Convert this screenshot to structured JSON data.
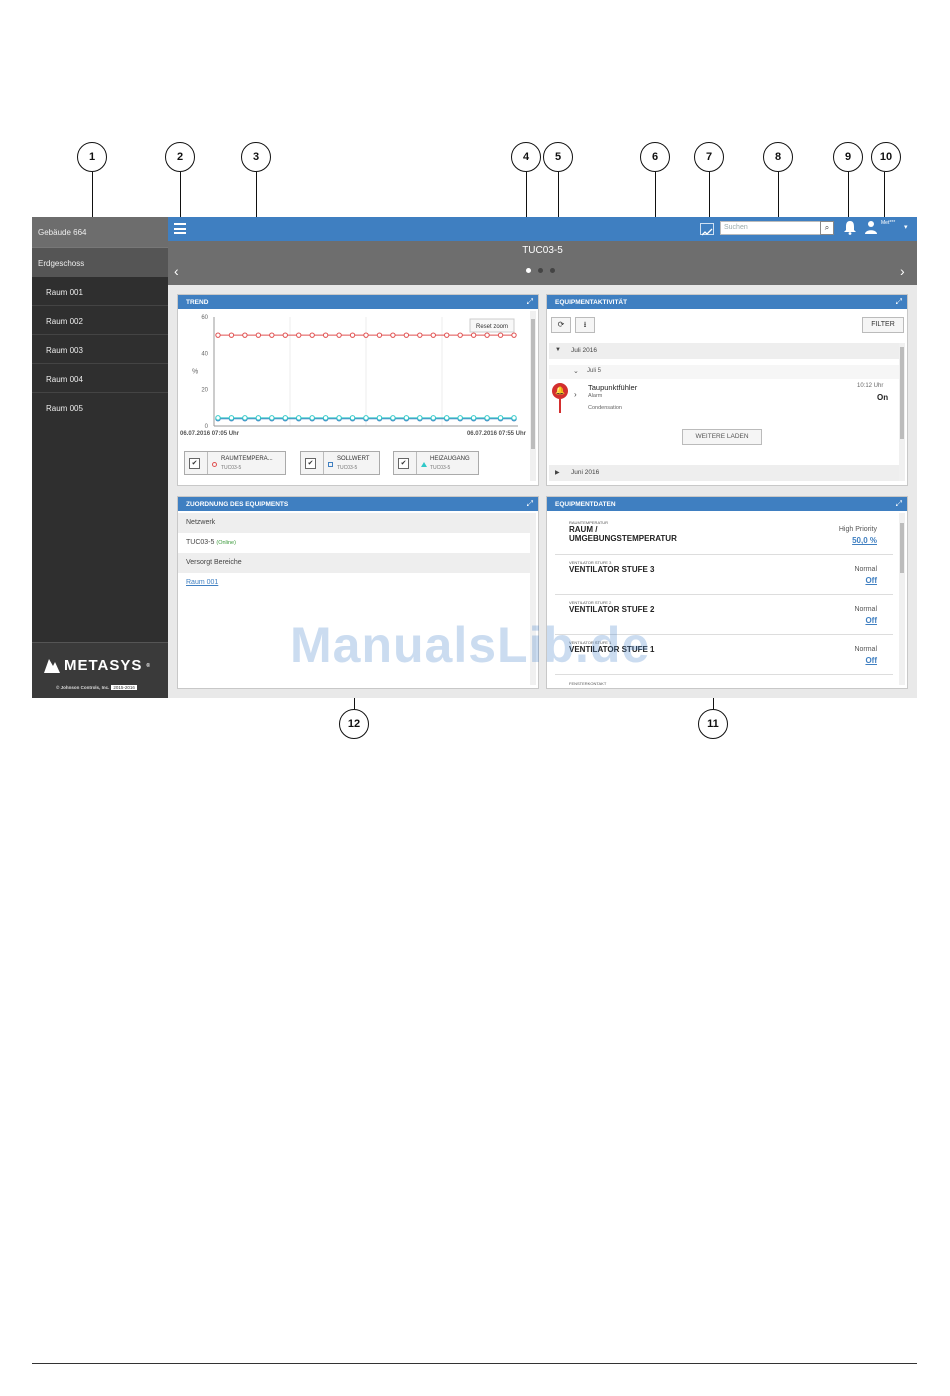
{
  "callouts": [
    "1",
    "2",
    "3",
    "4",
    "5",
    "6",
    "7",
    "8",
    "9",
    "10",
    "11",
    "12"
  ],
  "sidebar": {
    "building": "Gebäude 664",
    "floor": "Erdgeschoss",
    "rooms": [
      "Raum 001",
      "Raum 002",
      "Raum 003",
      "Raum 004",
      "Raum 005"
    ],
    "logo": "METASYS",
    "logo_mark": "®",
    "copyright": "© Johnson Controls, Inc.",
    "copyright_years": "2015-2016"
  },
  "topbar": {
    "search_placeholder": "Suchen",
    "search_button": "⌕",
    "user": "Met***",
    "icons": [
      "menu-icon",
      "trend-icon",
      "search-icon",
      "bell-icon",
      "user-icon",
      "caret-down-icon"
    ]
  },
  "banner": {
    "title": "TUC03-5",
    "pages": 3,
    "active_page": 0
  },
  "trend": {
    "title": "TREND",
    "reset_zoom": "Reset zoom",
    "x_start": "06.07.2016 07:05 Uhr",
    "x_end": "06.07.2016 07:55 Uhr",
    "y_unit": "%",
    "legend": [
      {
        "name": "RAUMTEMPERA...",
        "sub": "TUC03-5",
        "color": "#e05050"
      },
      {
        "name": "SOLLWERT",
        "sub": "TUC03-5",
        "color": "#3f7fc1"
      },
      {
        "name": "HEIZAUGANG",
        "sub": "TUC03-5",
        "color": "#30c8c8"
      }
    ]
  },
  "chart_data": {
    "type": "line",
    "title": "",
    "xlabel": "",
    "ylabel": "%",
    "x_range": [
      "06.07.2016 07:05 Uhr",
      "06.07.2016 07:55 Uhr"
    ],
    "y_ticks": [
      0,
      20,
      40,
      60
    ],
    "ylim": [
      0,
      60
    ],
    "points_per_series": 23,
    "series": [
      {
        "name": "RAUMTEMPERA...",
        "color": "#e05050",
        "values": [
          50,
          50,
          50,
          50,
          50,
          50,
          50,
          50,
          50,
          50,
          50,
          50,
          50,
          50,
          50,
          50,
          50,
          50,
          50,
          50,
          50,
          50,
          50
        ]
      },
      {
        "name": "SOLLWERT",
        "color": "#3f7fc1",
        "values": [
          4,
          4,
          4,
          4,
          4,
          4,
          4,
          4,
          4,
          4,
          4,
          4,
          4,
          4,
          4,
          4,
          4,
          4,
          4,
          4,
          4,
          4,
          4
        ]
      },
      {
        "name": "HEIZAUGANG",
        "color": "#30c8c8",
        "values": [
          4.5,
          4.5,
          4.5,
          4.5,
          4.5,
          4.5,
          4.5,
          4.5,
          4.5,
          4.5,
          4.5,
          4.5,
          4.5,
          4.5,
          4.5,
          4.5,
          4.5,
          4.5,
          4.5,
          4.5,
          4.5,
          4.5,
          4.5
        ]
      }
    ],
    "grid": true
  },
  "activity": {
    "title": "EQUIPMENTAKTIVITÄT",
    "filter": "FILTER",
    "month1": "Juli 2016",
    "day1": "Juli 5",
    "event": {
      "name": "Taupunktfühler",
      "type": "Alarm",
      "desc": "Condensation",
      "time": "10:12 Uhr",
      "value": "On"
    },
    "load_more": "WEITERE LADEN",
    "month2": "Juni 2016"
  },
  "mapping": {
    "title": "ZUORDNUNG DES EQUIPMENTS",
    "network_label": "Netzwerk",
    "device": "TUC03-5",
    "device_status": "(Online)",
    "served_label": "Versorgt Bereiche",
    "served_link": "Raum 001"
  },
  "equipment": {
    "title": "EQUIPMENTDATEN",
    "rows": [
      {
        "small": "RAUMTEMPERATUR",
        "name1": "RAUM /",
        "name2": "UMGEBUNGSTEMPERATUR",
        "status": "High Priority",
        "value": "50,0 %"
      },
      {
        "small": "VENTILATOR STUFE 3",
        "name1": "VENTILATOR STUFE 3",
        "name2": "",
        "status": "Normal",
        "value": "Off"
      },
      {
        "small": "VENTILATOR STUFE 2",
        "name1": "VENTILATOR STUFE 2",
        "name2": "",
        "status": "Normal",
        "value": "Off"
      },
      {
        "small": "VENTILATOR STUFE 1",
        "name1": "VENTILATOR STUFE 1",
        "name2": "",
        "status": "Normal",
        "value": "Off"
      }
    ],
    "cut_row": "FENSTERKONTAKT"
  },
  "watermark": "ManualsLib.de"
}
